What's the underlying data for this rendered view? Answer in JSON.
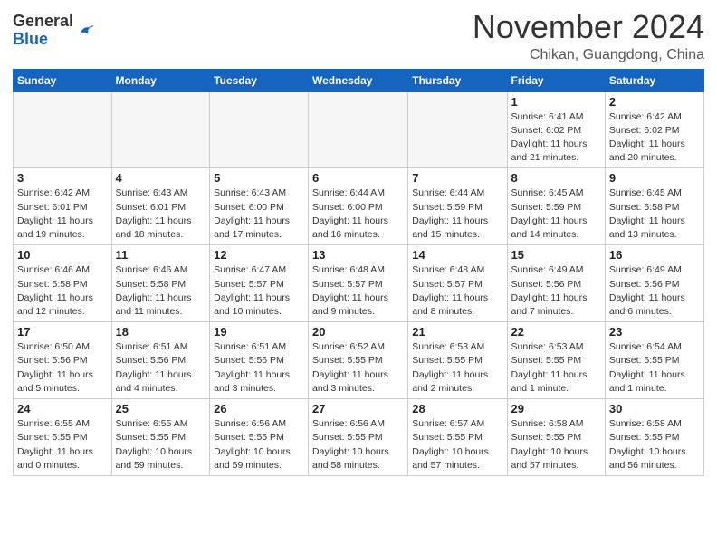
{
  "header": {
    "logo": {
      "general": "General",
      "blue": "Blue"
    },
    "month": "November 2024",
    "location": "Chikan, Guangdong, China"
  },
  "weekdays": [
    "Sunday",
    "Monday",
    "Tuesday",
    "Wednesday",
    "Thursday",
    "Friday",
    "Saturday"
  ],
  "weeks": [
    [
      {
        "day": "",
        "empty": true
      },
      {
        "day": "",
        "empty": true
      },
      {
        "day": "",
        "empty": true
      },
      {
        "day": "",
        "empty": true
      },
      {
        "day": "",
        "empty": true
      },
      {
        "day": "1",
        "sunrise": "6:41 AM",
        "sunset": "6:02 PM",
        "daylight": "11 hours and 21 minutes."
      },
      {
        "day": "2",
        "sunrise": "6:42 AM",
        "sunset": "6:02 PM",
        "daylight": "11 hours and 20 minutes."
      }
    ],
    [
      {
        "day": "3",
        "sunrise": "6:42 AM",
        "sunset": "6:01 PM",
        "daylight": "11 hours and 19 minutes."
      },
      {
        "day": "4",
        "sunrise": "6:43 AM",
        "sunset": "6:01 PM",
        "daylight": "11 hours and 18 minutes."
      },
      {
        "day": "5",
        "sunrise": "6:43 AM",
        "sunset": "6:00 PM",
        "daylight": "11 hours and 17 minutes."
      },
      {
        "day": "6",
        "sunrise": "6:44 AM",
        "sunset": "6:00 PM",
        "daylight": "11 hours and 16 minutes."
      },
      {
        "day": "7",
        "sunrise": "6:44 AM",
        "sunset": "5:59 PM",
        "daylight": "11 hours and 15 minutes."
      },
      {
        "day": "8",
        "sunrise": "6:45 AM",
        "sunset": "5:59 PM",
        "daylight": "11 hours and 14 minutes."
      },
      {
        "day": "9",
        "sunrise": "6:45 AM",
        "sunset": "5:58 PM",
        "daylight": "11 hours and 13 minutes."
      }
    ],
    [
      {
        "day": "10",
        "sunrise": "6:46 AM",
        "sunset": "5:58 PM",
        "daylight": "11 hours and 12 minutes."
      },
      {
        "day": "11",
        "sunrise": "6:46 AM",
        "sunset": "5:58 PM",
        "daylight": "11 hours and 11 minutes."
      },
      {
        "day": "12",
        "sunrise": "6:47 AM",
        "sunset": "5:57 PM",
        "daylight": "11 hours and 10 minutes."
      },
      {
        "day": "13",
        "sunrise": "6:48 AM",
        "sunset": "5:57 PM",
        "daylight": "11 hours and 9 minutes."
      },
      {
        "day": "14",
        "sunrise": "6:48 AM",
        "sunset": "5:57 PM",
        "daylight": "11 hours and 8 minutes."
      },
      {
        "day": "15",
        "sunrise": "6:49 AM",
        "sunset": "5:56 PM",
        "daylight": "11 hours and 7 minutes."
      },
      {
        "day": "16",
        "sunrise": "6:49 AM",
        "sunset": "5:56 PM",
        "daylight": "11 hours and 6 minutes."
      }
    ],
    [
      {
        "day": "17",
        "sunrise": "6:50 AM",
        "sunset": "5:56 PM",
        "daylight": "11 hours and 5 minutes."
      },
      {
        "day": "18",
        "sunrise": "6:51 AM",
        "sunset": "5:56 PM",
        "daylight": "11 hours and 4 minutes."
      },
      {
        "day": "19",
        "sunrise": "6:51 AM",
        "sunset": "5:56 PM",
        "daylight": "11 hours and 3 minutes."
      },
      {
        "day": "20",
        "sunrise": "6:52 AM",
        "sunset": "5:55 PM",
        "daylight": "11 hours and 3 minutes."
      },
      {
        "day": "21",
        "sunrise": "6:53 AM",
        "sunset": "5:55 PM",
        "daylight": "11 hours and 2 minutes."
      },
      {
        "day": "22",
        "sunrise": "6:53 AM",
        "sunset": "5:55 PM",
        "daylight": "11 hours and 1 minute."
      },
      {
        "day": "23",
        "sunrise": "6:54 AM",
        "sunset": "5:55 PM",
        "daylight": "11 hours and 1 minute."
      }
    ],
    [
      {
        "day": "24",
        "sunrise": "6:55 AM",
        "sunset": "5:55 PM",
        "daylight": "11 hours and 0 minutes."
      },
      {
        "day": "25",
        "sunrise": "6:55 AM",
        "sunset": "5:55 PM",
        "daylight": "10 hours and 59 minutes."
      },
      {
        "day": "26",
        "sunrise": "6:56 AM",
        "sunset": "5:55 PM",
        "daylight": "10 hours and 59 minutes."
      },
      {
        "day": "27",
        "sunrise": "6:56 AM",
        "sunset": "5:55 PM",
        "daylight": "10 hours and 58 minutes."
      },
      {
        "day": "28",
        "sunrise": "6:57 AM",
        "sunset": "5:55 PM",
        "daylight": "10 hours and 57 minutes."
      },
      {
        "day": "29",
        "sunrise": "6:58 AM",
        "sunset": "5:55 PM",
        "daylight": "10 hours and 57 minutes."
      },
      {
        "day": "30",
        "sunrise": "6:58 AM",
        "sunset": "5:55 PM",
        "daylight": "10 hours and 56 minutes."
      }
    ]
  ]
}
